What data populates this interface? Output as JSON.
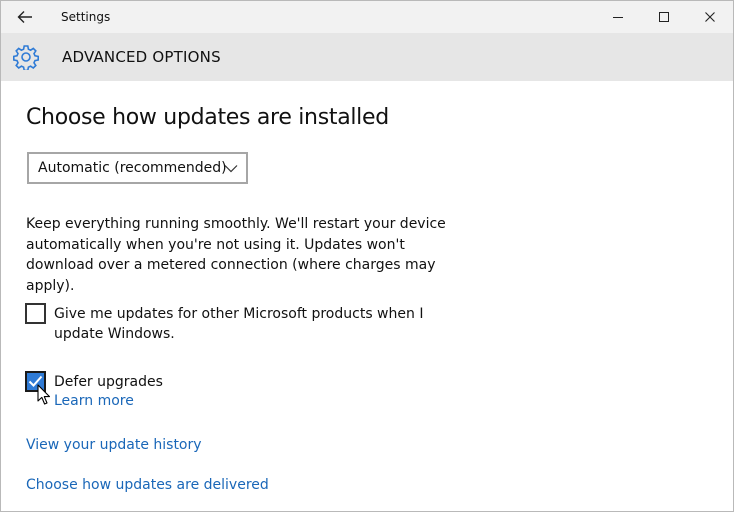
{
  "window": {
    "title": "Settings",
    "icons": {
      "back": "back-arrow-icon",
      "minimize": "minimize-icon",
      "maximize": "maximize-icon",
      "close": "close-icon"
    }
  },
  "header": {
    "icon": "gear-icon",
    "title": "ADVANCED OPTIONS"
  },
  "main": {
    "heading": "Choose how updates are installed",
    "install_dropdown": {
      "selected": "Automatic (recommended)"
    },
    "description": "Keep everything running smoothly. We'll restart your device automatically when you're not using it. Updates won't download over a metered connection (where charges may apply).",
    "checkboxes": [
      {
        "label": "Give me updates for other Microsoft products when I update Windows.",
        "checked": false
      },
      {
        "label": "Defer upgrades",
        "checked": true
      }
    ],
    "learn_more": "Learn more",
    "links": {
      "history": "View your update history",
      "delivered": "Choose how updates are delivered"
    }
  },
  "colors": {
    "accent": "#2f7bd6",
    "link": "#1a67b8",
    "header_bg": "#e6e6e6",
    "titlebar_bg": "#f2f2f2"
  }
}
